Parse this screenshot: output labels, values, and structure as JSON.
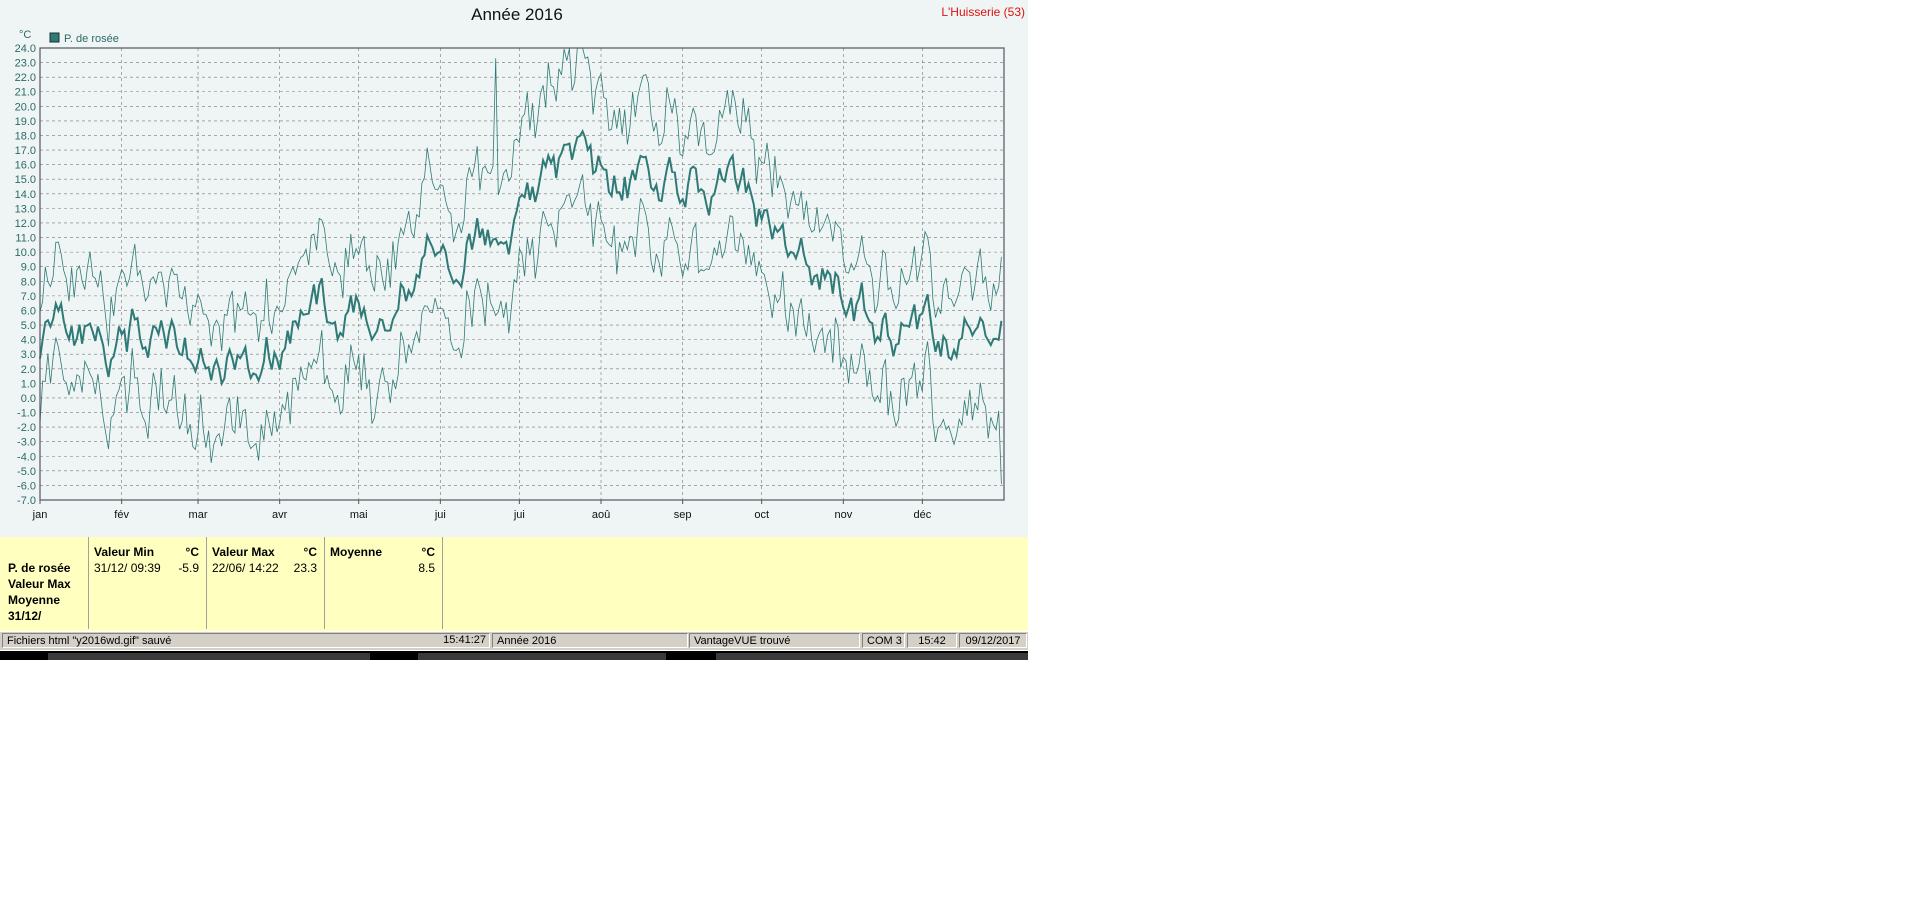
{
  "location": "L'Huisserie (53)",
  "chart_data": {
    "type": "line",
    "title": "Année 2016",
    "ylabel": "°C",
    "ylim": [
      -7,
      24
    ],
    "yticks": [
      "24.0",
      "23.0",
      "22.0",
      "21.0",
      "20.0",
      "19.0",
      "18.0",
      "17.0",
      "16.0",
      "15.0",
      "14.0",
      "13.0",
      "12.0",
      "11.0",
      "10.0",
      "9.0",
      "8.0",
      "7.0",
      "6.0",
      "5.0",
      "4.0",
      "3.0",
      "2.0",
      "1.0",
      "0.0",
      "-1.0",
      "-2.0",
      "-3.0",
      "-4.0",
      "-5.0",
      "-6.0",
      "-7.0"
    ],
    "xlim": [
      0,
      366
    ],
    "categories": [
      "jan",
      "fév",
      "mar",
      "avr",
      "mai",
      "jui",
      "jui",
      "aoû",
      "sep",
      "oct",
      "nov",
      "déc"
    ],
    "month_start_days": [
      0,
      31,
      60,
      91,
      121,
      152,
      182,
      213,
      244,
      274,
      305,
      335
    ],
    "grid": true,
    "legend": "top-left",
    "legend_entries": [
      "P. de rosée"
    ],
    "colors": {
      "series": "#2f7a76",
      "grid": "#777777",
      "frame": "#556"
    },
    "monthly_mean": [
      4.0,
      4.5,
      2.5,
      5.5,
      7.5,
      12.0,
      14.5,
      14.5,
      15.0,
      9.5,
      5.0,
      4.0
    ],
    "monthly_high": [
      7.5,
      8.5,
      6.0,
      9.5,
      12.0,
      16.5,
      19.5,
      19.0,
      19.0,
      13.0,
      8.5,
      7.5
    ],
    "monthly_low": [
      0.5,
      0.0,
      -1.5,
      1.0,
      3.5,
      8.0,
      10.0,
      10.0,
      10.5,
      5.5,
      1.0,
      -1.5
    ],
    "min": {
      "day": 365,
      "value": -5.9
    },
    "max": {
      "day": 173,
      "value": 23.3
    },
    "mean": 8.5
  },
  "summary": {
    "row_labels": [
      "P. de rosée",
      "Valeur Max",
      "Moyenne",
      "31/12/"
    ],
    "min": {
      "header": "Valeur Min",
      "unit": "°C",
      "date": "31/12/  09:39",
      "value": "-5.9"
    },
    "max": {
      "header": "Valeur Max",
      "unit": "°C",
      "date": "22/06/  14:22",
      "value": "23.3"
    },
    "avg": {
      "header": "Moyenne",
      "unit": "°C",
      "value": "8.5"
    }
  },
  "status": {
    "message": "Fichiers html  \"y2016wd.gif\"  sauvé",
    "time": "15:41:27",
    "period": "Année 2016",
    "station": "VantageVUE trouvé",
    "port": "COM 3",
    "clock": "15:42",
    "date": "09/12/2017"
  }
}
